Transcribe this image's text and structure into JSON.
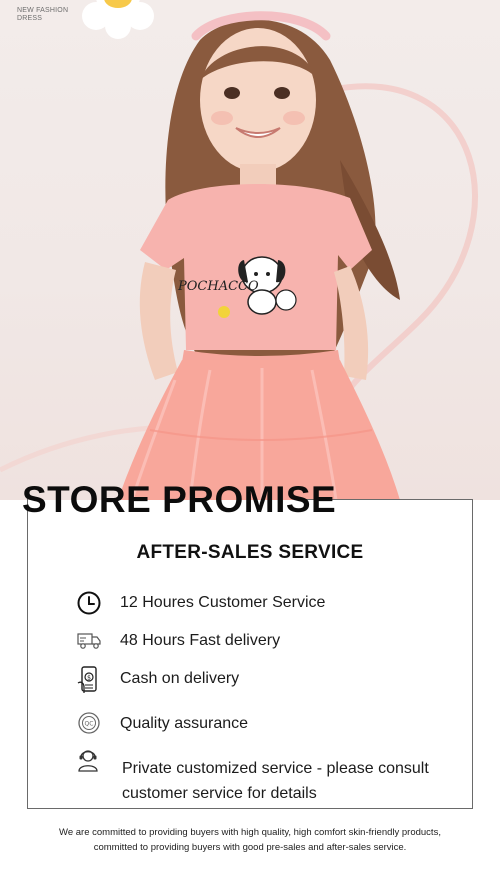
{
  "hero": {
    "tag": "NEW FASHION DRESS",
    "print_text": "POCHACCO"
  },
  "promise": {
    "title": "STORE PROMISE",
    "heading": "AFTER-SALES SERVICE",
    "services": [
      {
        "icon": "clock-icon",
        "label": "12 Houres Customer Service"
      },
      {
        "icon": "delivery-truck-icon",
        "label": "48 Hours Fast delivery"
      },
      {
        "icon": "cash-phone-icon",
        "label": "Cash on delivery"
      },
      {
        "icon": "quality-badge-icon",
        "label": "Quality assurance"
      },
      {
        "icon": "customer-support-icon",
        "label": "Private customized service - please consult customer service for details"
      }
    ]
  },
  "footer": {
    "line1": "We are committed to providing buyers with high quality, high comfort skin-friendly products,",
    "line2": "committed to providing buyers with good pre-sales and after-sales service."
  },
  "colors": {
    "dress_pink": "#f7b3ae",
    "tulle_pink": "#f8a79b",
    "text": "#111111",
    "border": "#6a6a6a"
  }
}
